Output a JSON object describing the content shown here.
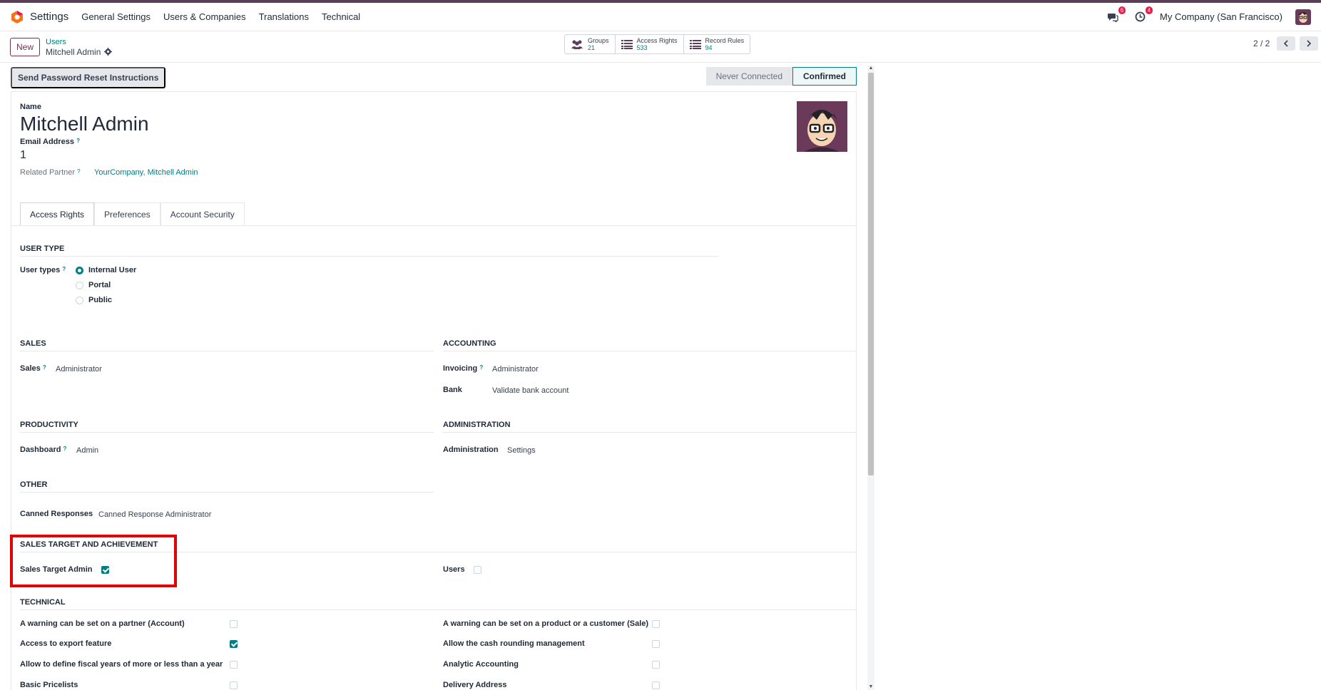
{
  "navbar": {
    "app_name": "Settings",
    "menus": [
      "General Settings",
      "Users & Companies",
      "Translations",
      "Technical"
    ],
    "messages_count": "6",
    "activities_count": "4",
    "company": "My Company (San Francisco)"
  },
  "control": {
    "new_label": "New",
    "breadcrumb_parent": "Users",
    "breadcrumb_current": "Mitchell Admin",
    "pager": "2 / 2"
  },
  "smart_buttons": [
    {
      "label": "Groups",
      "value": "21"
    },
    {
      "label": "Access Rights",
      "value": "533"
    },
    {
      "label": "Record Rules",
      "value": "94"
    }
  ],
  "statusbar": {
    "reset_label": "Send Password Reset Instructions",
    "stages": [
      "Never Connected",
      "Confirmed"
    ],
    "active_stage": "Confirmed"
  },
  "form": {
    "name_label": "Name",
    "name": "Mitchell Admin",
    "email_label": "Email Address",
    "email": "1",
    "partner_label": "Related Partner",
    "partner": "YourCompany, Mitchell Admin",
    "tabs": [
      "Access Rights",
      "Preferences",
      "Account Security"
    ]
  },
  "sections": {
    "user_type": "USER TYPE",
    "user_types_label": "User types",
    "user_types": [
      "Internal User",
      "Portal",
      "Public"
    ],
    "sales": "SALES",
    "sales_label": "Sales",
    "sales_value": "Administrator",
    "accounting": "ACCOUNTING",
    "invoicing_label": "Invoicing",
    "invoicing_value": "Administrator",
    "bank_label": "Bank",
    "bank_value": "Validate bank account",
    "productivity": "PRODUCTIVITY",
    "dashboard_label": "Dashboard",
    "dashboard_value": "Admin",
    "administration": "ADMINISTRATION",
    "administration_label": "Administration",
    "administration_value": "Settings",
    "other": "OTHER",
    "canned_label": "Canned Responses",
    "canned_value": "Canned Response Administrator",
    "sales_target": "SALES TARGET AND ACHIEVEMENT",
    "sales_target_admin": "Sales Target Admin",
    "users_label": "Users",
    "technical": "TECHNICAL",
    "tech_left": [
      "A warning can be set on a partner (Account)",
      "Access to export feature",
      "Allow to define fiscal years of more or less than a year",
      "Basic Pricelists"
    ],
    "tech_right": [
      "A warning can be set on a product or a customer (Sale)",
      "Allow the cash rounding management",
      "Analytic Accounting",
      "Delivery Address"
    ]
  },
  "colors": {
    "brand": "#71324f",
    "accent": "#017e84",
    "highlight": "#e00000"
  }
}
